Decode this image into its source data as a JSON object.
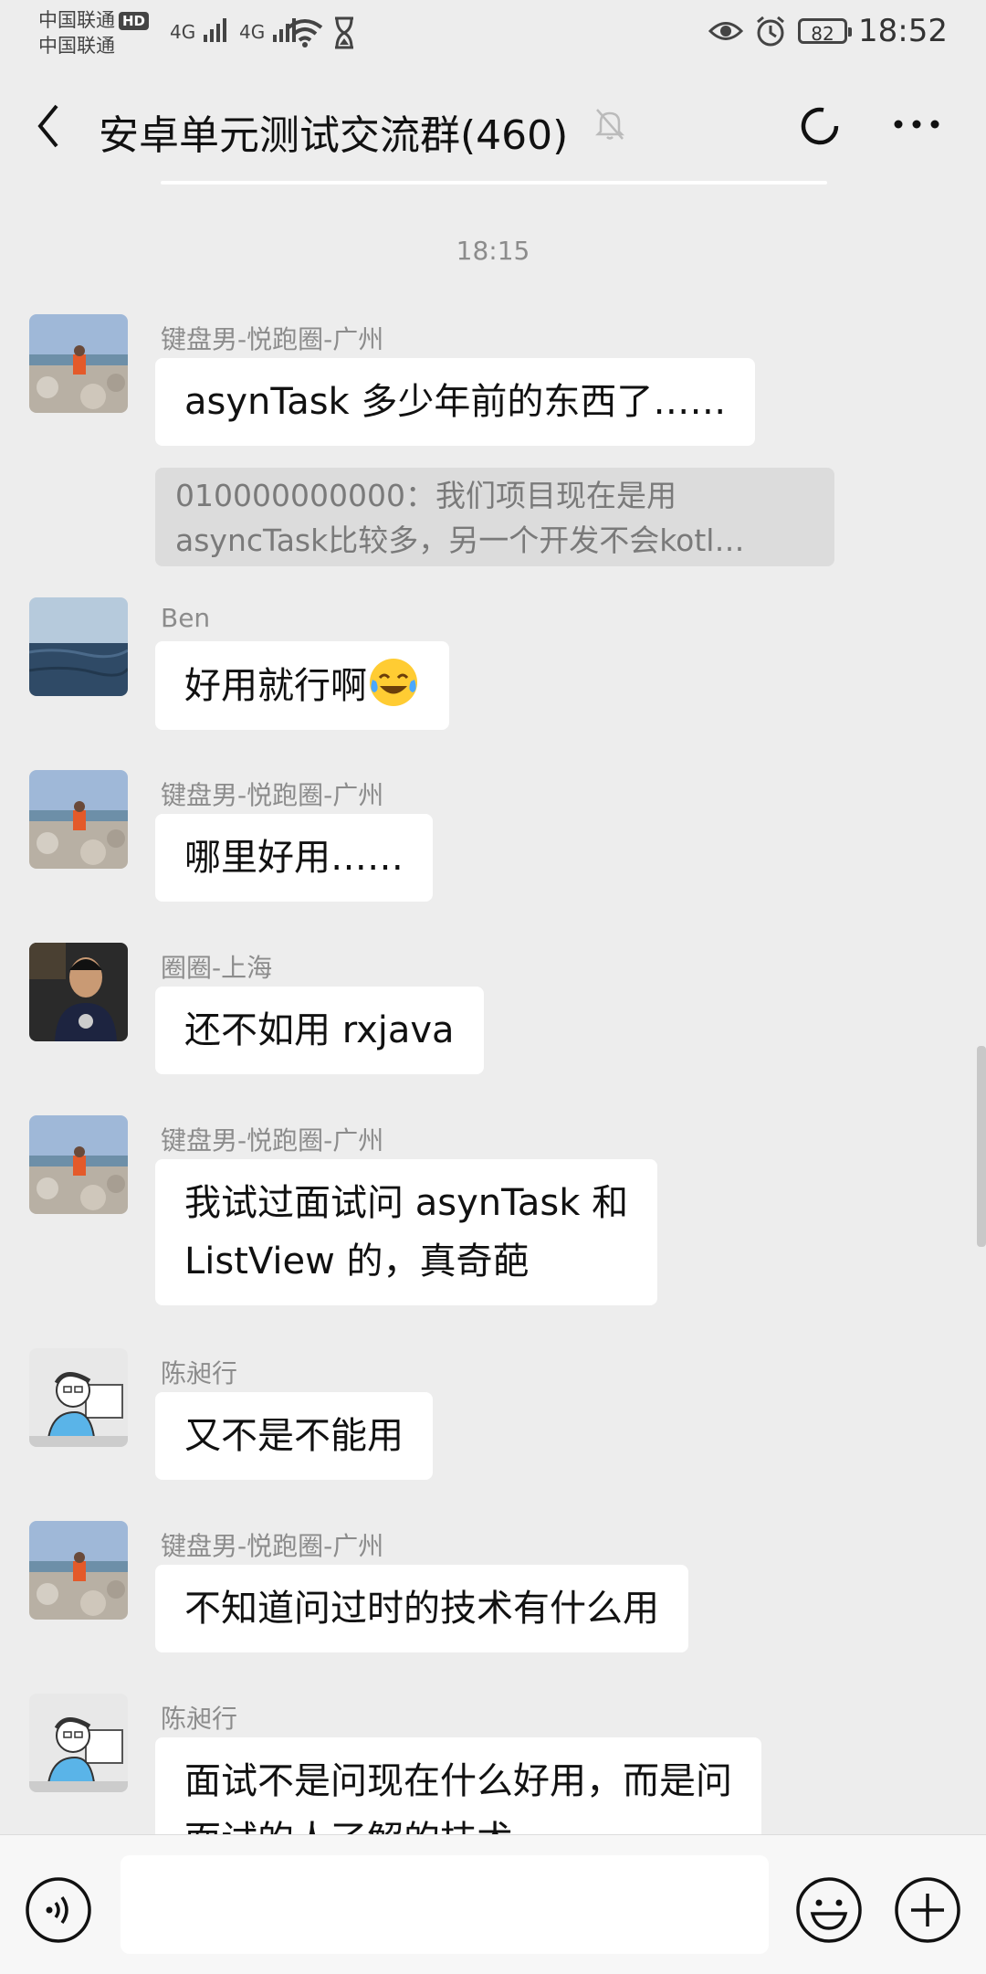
{
  "status_bar": {
    "carrier_1": "中国联通",
    "hd": "HD",
    "carrier_2": "中国联通",
    "net_1": "4G",
    "net_2": "4G",
    "battery": "82",
    "time": "18:52"
  },
  "header": {
    "title": "安卓单元测试交流群(460)"
  },
  "timestamp": "18:15",
  "messages": [
    {
      "sender": "键盘男-悦跑圈-广州",
      "text": "asynTask 多少年前的东西了……",
      "avatar": "rocks-photo"
    },
    {
      "quote_line1": "010000000000：我们项目现在是用",
      "quote_line2": "asyncTask比较多，另一个开发不会kotl…"
    },
    {
      "sender": "Ben",
      "text": "好用就行啊",
      "emoji": "tears-of-joy-emoji",
      "avatar": "sea-photo"
    },
    {
      "sender": "键盘男-悦跑圈-广州",
      "text": "哪里好用……",
      "avatar": "rocks-photo"
    },
    {
      "sender": "圈圈-上海",
      "text": "还不如用 rxjava",
      "avatar": "person-photo"
    },
    {
      "sender": "键盘男-悦跑圈-广州",
      "line1": "我试过面试问 asynTask 和",
      "line2": "ListView 的，真奇葩",
      "avatar": "rocks-photo"
    },
    {
      "sender": "陈昶行",
      "text": "又不是不能用",
      "avatar": "cartoon-coder"
    },
    {
      "sender": "键盘男-悦跑圈-广州",
      "text": "不知道问过时的技术有什么用",
      "avatar": "rocks-photo"
    },
    {
      "sender": "陈昶行",
      "line1": "面试不是问现在什么好用，而是问",
      "line2": "面试的人了解的技术",
      "avatar": "cartoon-coder"
    }
  ],
  "input": {
    "value": ""
  },
  "colors": {
    "background": "#ededed",
    "bubble": "#ffffff",
    "meta_text": "#8c8c8c",
    "quote_bg": "#dcdcdc"
  }
}
